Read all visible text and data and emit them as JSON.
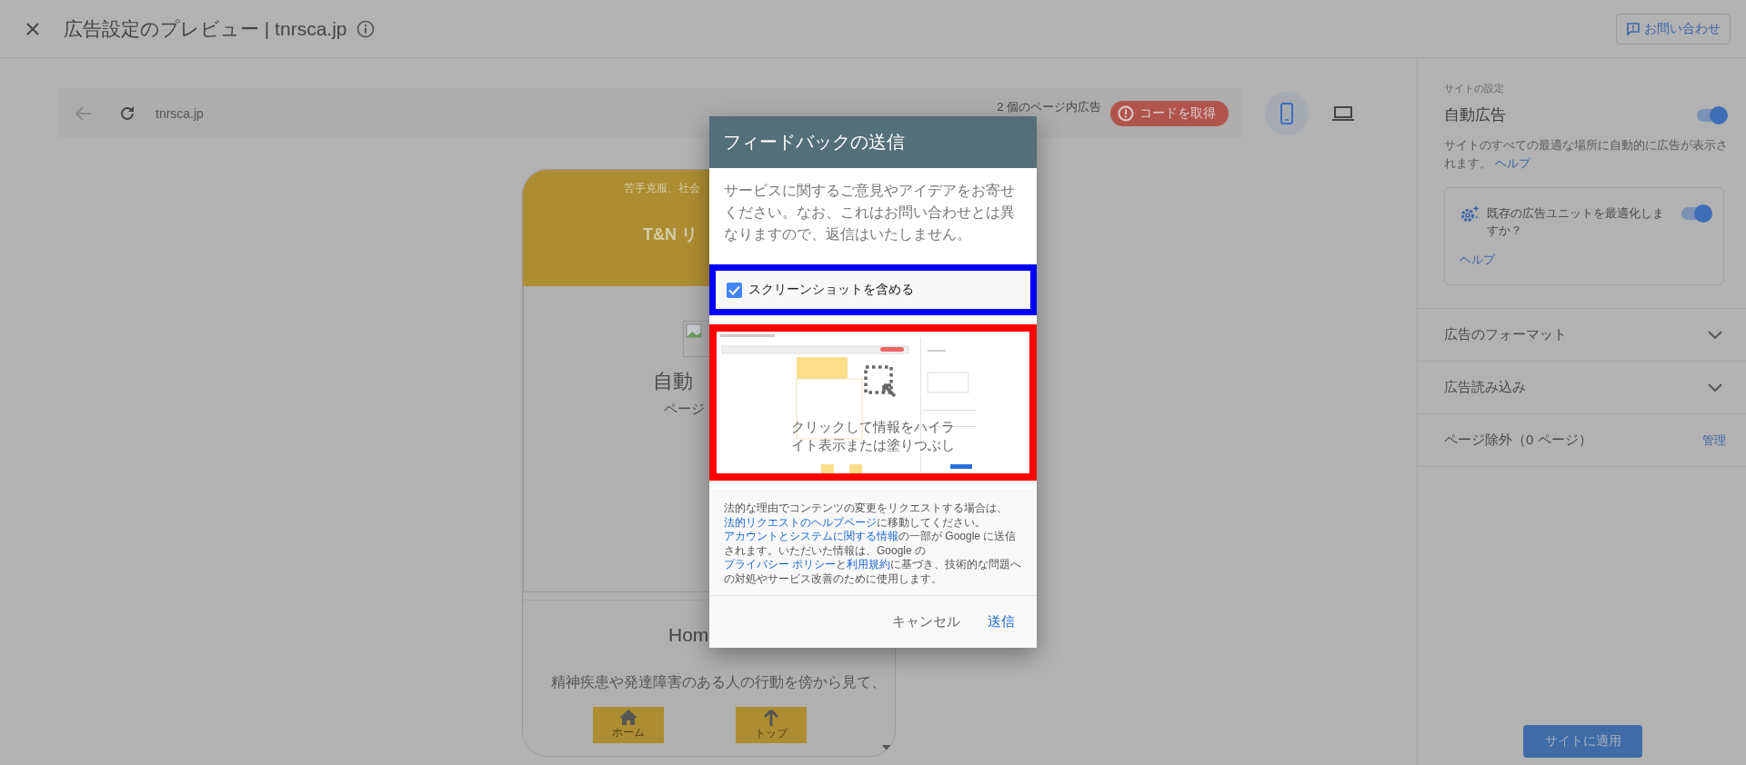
{
  "header": {
    "title": "広告設定のプレビュー | tnrsca.jp",
    "contact_button": "お問い合わせ"
  },
  "preview_toolbar": {
    "url": "tnrsca.jp",
    "ad_count": "2 個のページ内広告",
    "get_code_button": "コードを取得",
    "devices": [
      {
        "kind": "phone",
        "selected": true
      },
      {
        "kind": "laptop",
        "selected": false
      }
    ]
  },
  "site_preview": {
    "tagline": "苦手克服、社会",
    "site_title": "T&N リ",
    "heading": "自動",
    "subheading": "ページ",
    "card_title": "Hom",
    "card_text": "精神疾患や発達障害のある人の行動を傍から見て、",
    "nav": [
      {
        "kind": "home",
        "label": "ホーム"
      },
      {
        "kind": "top",
        "label": "トップ"
      }
    ]
  },
  "feedback_dialog": {
    "title": "フィードバックの送信",
    "description": "サービスに関するご意見やアイデアをお寄せください。なお、これはお問い合わせとは異なりますので、返信はいたしません。",
    "include_screenshot": {
      "label": "スクリーンショットを含める",
      "checked": true
    },
    "screenshot_hint": "クリックして情報をハイライト表示または塗りつぶし",
    "legal_notice": [
      {
        "text": "法的な理由でコンテンツの変更をリクエストする場合は、",
        "link": false
      },
      {
        "text": "法的リクエストのヘルプページ",
        "link": true
      },
      {
        "text": "に移動してください。",
        "link": false
      },
      {
        "text": "アカウントとシステムに関する情報",
        "link": true
      },
      {
        "text": "の一部が Google に送信されます。いただいた情報は、Google の",
        "link": false
      },
      {
        "text": "プライバシー ポリシー",
        "link": true
      },
      {
        "text": "と",
        "link": false
      },
      {
        "text": "利用規約",
        "link": true
      },
      {
        "text": "に基づき、技術的な問題への対処やサービス改善のために使用します。",
        "link": false
      }
    ],
    "buttons": [
      {
        "label": "キャンセル",
        "kind": "secondary"
      },
      {
        "label": "送信",
        "kind": "primary"
      }
    ]
  },
  "settings": {
    "section_label": "サイトの設定",
    "auto_ads": {
      "title": "自動広告",
      "on": true,
      "description": "サイトのすべての最適な場所に自動的に広告が表示されます。",
      "help_link": "ヘルプ"
    },
    "optimize_card": {
      "text": "既存の広告ユニットを最適化しますか？",
      "on": true,
      "help_link": "ヘルプ"
    },
    "rows": [
      {
        "kind": "expand",
        "label": "広告のフォーマット",
        "expanded": false
      },
      {
        "kind": "expand",
        "label": "広告読み込み",
        "expanded": false
      },
      {
        "kind": "action",
        "label": "ページ除外（0 ページ）",
        "action": "管理"
      }
    ],
    "apply_button": "サイトに適用"
  }
}
